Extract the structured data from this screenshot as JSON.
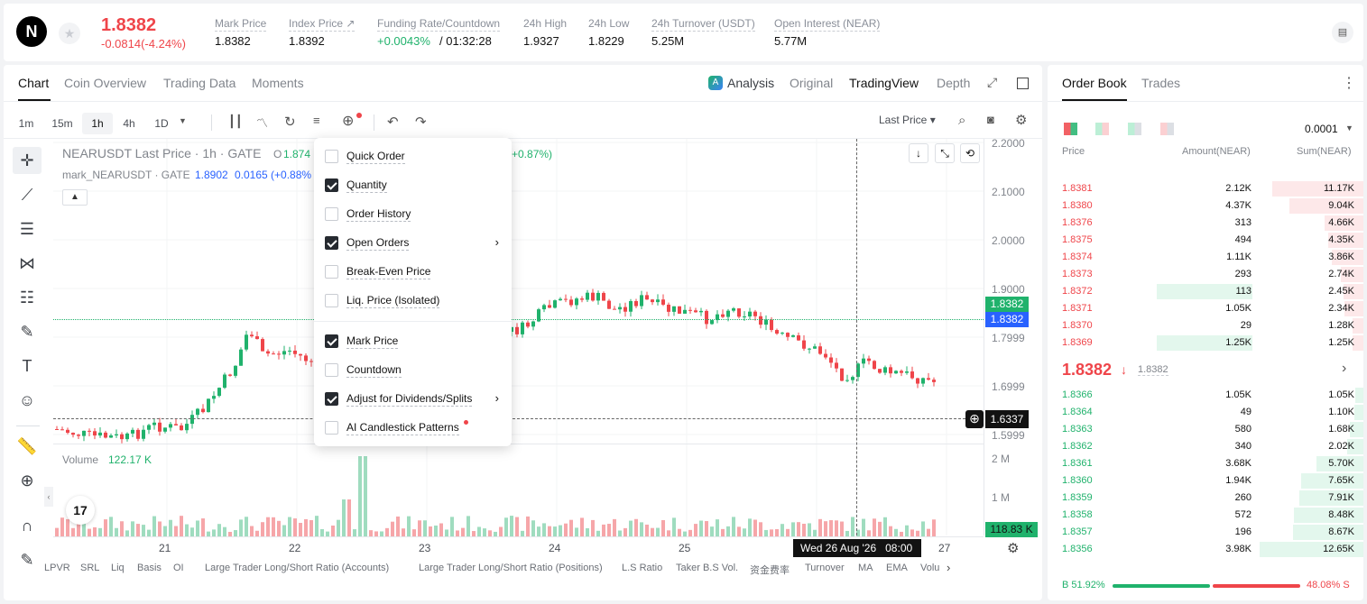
{
  "colors": {
    "up": "#20b26c",
    "down": "#ef454a",
    "accent": "#121212"
  },
  "header": {
    "logo_icon": "near-logo-icon",
    "last_price": "1.8382",
    "change": "-0.0814(-4.24%)",
    "stats": [
      {
        "label": "Mark Price",
        "value": "1.8382"
      },
      {
        "label": "Index Price ↗",
        "value": "1.8392"
      },
      {
        "label": "Funding Rate/Countdown",
        "value": "+0.0043%",
        "extra": "/ 01:32:28"
      },
      {
        "label": "24h High",
        "value": "1.9327"
      },
      {
        "label": "24h Low",
        "value": "1.8229"
      },
      {
        "label": "24h Turnover (USDT)",
        "value": "5.25M"
      },
      {
        "label": "Open Interest (NEAR)",
        "value": "5.77M"
      }
    ]
  },
  "chart_tabs": [
    "Chart",
    "Coin Overview",
    "Trading Data",
    "Moments"
  ],
  "view_tabs": [
    "Analysis",
    "Original",
    "TradingView",
    "Depth"
  ],
  "timeframes": [
    "1m",
    "15m",
    "1h",
    "4h",
    "1D"
  ],
  "active_timeframe": "1h",
  "price_type": "Last Price ▾",
  "legend": {
    "title": "NEARUSDT Last Price · 1h · GATE",
    "o_label": "O",
    "o_value": "1.874",
    "change": "+0.87%)",
    "mark_title": "mark_NEARUSDT · GATE",
    "mark_price": "1.8902",
    "mark_change": "0.0165 (+0.88%"
  },
  "price_axis": [
    "2.2000",
    "2.1000",
    "2.0000",
    "1.9000",
    "1.7999",
    "1.6999",
    "1.5999"
  ],
  "price_tags": {
    "last": "1.8382",
    "mark": "1.8382",
    "crosshair": "1.6337",
    "volume": "118.83 K"
  },
  "volume": {
    "label": "Volume",
    "value": "122.17 K",
    "axis": [
      "2 M",
      "1 M"
    ]
  },
  "time_axis": [
    "21",
    "22",
    "23",
    "24",
    "25",
    "27"
  ],
  "crosshair_time": "Wed 26 Aug '26   08:00",
  "indicator_tabs": [
    "LPVR",
    "SRL",
    "Liq",
    "Basis",
    "OI",
    "Large Trader Long/Short Ratio (Accounts)",
    "Large Trader Long/Short Ratio (Positions)",
    "L.S Ratio",
    "Taker B.S Vol.",
    "资金费率",
    "Turnover",
    "MA",
    "EMA",
    "Volu"
  ],
  "menu": {
    "items": [
      {
        "label": "Quick Order",
        "checked": false
      },
      {
        "label": "Quantity",
        "checked": true
      },
      {
        "label": "Order History",
        "checked": false
      },
      {
        "label": "Open Orders",
        "checked": true,
        "submenu": true
      },
      {
        "label": "Break-Even Price",
        "checked": false
      },
      {
        "label": "Liq. Price (Isolated)",
        "checked": false
      },
      {
        "label": "Mark Price",
        "checked": true
      },
      {
        "label": "Countdown",
        "checked": false
      },
      {
        "label": "Adjust for Dividends/Splits",
        "checked": true,
        "submenu": true
      },
      {
        "label": "AI Candlestick Patterns",
        "checked": false,
        "dot": true
      }
    ]
  },
  "orderbook": {
    "tabs": [
      "Order Book",
      "Trades"
    ],
    "precision": "0.0001",
    "headers": [
      "Price",
      "Amount(NEAR)",
      "Sum(NEAR)"
    ],
    "asks": [
      {
        "price": "1.8381",
        "amount": "2.12K",
        "sum": "11.17K",
        "depth": 0.88,
        "amt": 0
      },
      {
        "price": "1.8380",
        "amount": "4.37K",
        "sum": "9.04K",
        "depth": 0.71,
        "amt": 0
      },
      {
        "price": "1.8376",
        "amount": "313",
        "sum": "4.66K",
        "depth": 0.37,
        "amt": 0
      },
      {
        "price": "1.8375",
        "amount": "494",
        "sum": "4.35K",
        "depth": 0.34,
        "amt": 0
      },
      {
        "price": "1.8374",
        "amount": "1.11K",
        "sum": "3.86K",
        "depth": 0.3,
        "amt": 0
      },
      {
        "price": "1.8373",
        "amount": "293",
        "sum": "2.74K",
        "depth": 0.22,
        "amt": 0
      },
      {
        "price": "1.8372",
        "amount": "113",
        "sum": "2.45K",
        "depth": 0.19,
        "amt": 1
      },
      {
        "price": "1.8371",
        "amount": "1.05K",
        "sum": "2.34K",
        "depth": 0.18,
        "amt": 0
      },
      {
        "price": "1.8370",
        "amount": "29",
        "sum": "1.28K",
        "depth": 0.1,
        "amt": 0
      },
      {
        "price": "1.8369",
        "amount": "1.25K",
        "sum": "1.25K",
        "depth": 0.1,
        "amt": 1
      }
    ],
    "mid_price": "1.8382",
    "mid_mark": "1.8382",
    "bids": [
      {
        "price": "1.8366",
        "amount": "1.05K",
        "sum": "1.05K",
        "depth": 0.08
      },
      {
        "price": "1.8364",
        "amount": "49",
        "sum": "1.10K",
        "depth": 0.09
      },
      {
        "price": "1.8363",
        "amount": "580",
        "sum": "1.68K",
        "depth": 0.13
      },
      {
        "price": "1.8362",
        "amount": "340",
        "sum": "2.02K",
        "depth": 0.16
      },
      {
        "price": "1.8361",
        "amount": "3.68K",
        "sum": "5.70K",
        "depth": 0.45
      },
      {
        "price": "1.8360",
        "amount": "1.94K",
        "sum": "7.65K",
        "depth": 0.6
      },
      {
        "price": "1.8359",
        "amount": "260",
        "sum": "7.91K",
        "depth": 0.62
      },
      {
        "price": "1.8358",
        "amount": "572",
        "sum": "8.48K",
        "depth": 0.67
      },
      {
        "price": "1.8357",
        "amount": "196",
        "sum": "8.67K",
        "depth": 0.68
      },
      {
        "price": "1.8356",
        "amount": "3.98K",
        "sum": "12.65K",
        "depth": 1.0
      }
    ],
    "ratio_buy": "B 51.92%",
    "ratio_sell": "48.08% S",
    "buy_fraction": 0.5192
  }
}
